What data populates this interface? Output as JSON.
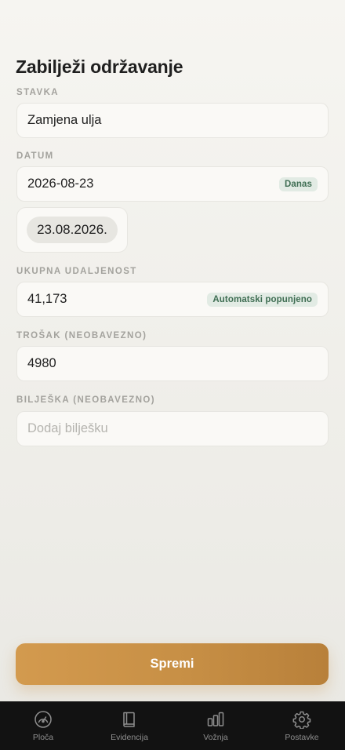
{
  "page": {
    "title": "Zabilježi održavanje"
  },
  "form": {
    "item": {
      "label": "STAVKA",
      "value": "Zamjena ulja"
    },
    "date": {
      "label": "DATUM",
      "value": "2026-08-23",
      "badge": "Danas",
      "picker_value": "23.08.2026."
    },
    "distance": {
      "label": "UKUPNA UDALJENOST",
      "value": "41,173",
      "badge": "Automatski popunjeno"
    },
    "cost": {
      "label": "TROŠAK (NEOBAVEZNO)",
      "value": "4980"
    },
    "note": {
      "label": "BILJEŠKA (NEOBAVEZNO)",
      "value": "",
      "placeholder": "Dodaj bilješku"
    }
  },
  "actions": {
    "save_label": "Spremi"
  },
  "tabbar": {
    "items": [
      {
        "label": "Ploča",
        "icon": "speedometer-icon"
      },
      {
        "label": "Evidencija",
        "icon": "book-icon"
      },
      {
        "label": "Vožnja",
        "icon": "bar-chart-icon"
      },
      {
        "label": "Postavke",
        "icon": "gear-icon"
      }
    ]
  },
  "colors": {
    "accent": "#c78f45",
    "badge_bg": "#e2ebe4",
    "badge_text": "#3f6e53",
    "tabbar_bg": "#121212"
  }
}
